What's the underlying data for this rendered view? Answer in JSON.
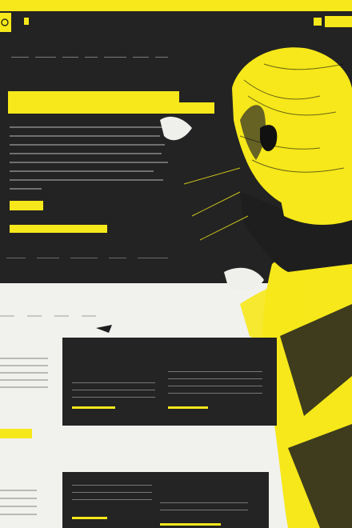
{
  "header": {
    "brand_label": "",
    "nav_items": [
      "",
      "",
      "",
      "",
      ""
    ]
  },
  "subnav": {
    "items": [
      "",
      "",
      "",
      "",
      "",
      "",
      ""
    ]
  },
  "hero": {
    "headline_line1": "",
    "headline_line2": "",
    "cta_primary": "",
    "cta_secondary": "",
    "stats": [
      "",
      "",
      "",
      "",
      ""
    ]
  },
  "section": {
    "left_title": "",
    "left_cta": "",
    "left_title_2": "",
    "card1": {
      "col1_title": "",
      "col1_sub": "",
      "col2_title": ""
    },
    "card2": {
      "col2_title": "",
      "col2_sub": ""
    }
  },
  "colors": {
    "accent": "#f6e81a",
    "dark_panel": "#232323",
    "background": "#f1f1ee",
    "muted_text": "#8d8d8d"
  },
  "icons": [
    "logo-mark-icon",
    "portrait-artwork"
  ]
}
